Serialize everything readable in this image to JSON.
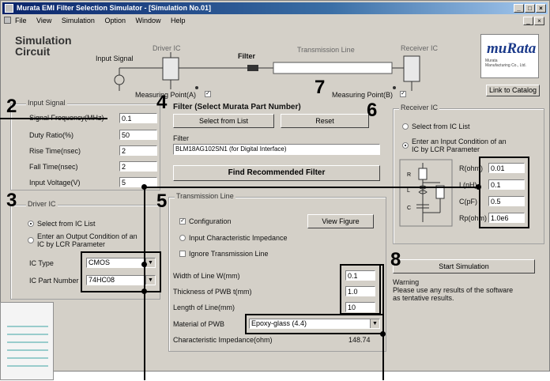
{
  "window": {
    "title": "Murata EMI Filter Selection Simulator - [Simulation No.01]",
    "min_label": "_",
    "max_label": "□",
    "close_label": "×"
  },
  "menu": [
    "File",
    "View",
    "Simulation",
    "Option",
    "Window",
    "Help"
  ],
  "circuit": {
    "heading_line1": "Simulation",
    "heading_line2": "Circuit",
    "input_signal": "Input Signal",
    "driver_ic": "Driver IC",
    "filter": "Filter",
    "transmission_line": "Transmission Line",
    "receiver_ic": "Receiver IC",
    "measuring_point_a": "Measuring Point(A)",
    "measuring_point_b": "Measuring Point(B)"
  },
  "logo": {
    "word": "muRata",
    "sub_line1": "Murata",
    "sub_line2": "Manufacturing Co., Ltd."
  },
  "link_catalog": "Link to Catalog",
  "input_signal": {
    "title": "Input Signal",
    "fields": [
      {
        "label": "Signal Frequency(MHz)",
        "value": "0.1"
      },
      {
        "label": "Duty Ratio(%)",
        "value": "50"
      },
      {
        "label": "Rise Time(nsec)",
        "value": "2"
      },
      {
        "label": "Fall Time(nsec)",
        "value": "2"
      },
      {
        "label": "Input Voltage(V)",
        "value": "5"
      }
    ]
  },
  "driver_ic": {
    "title": "Driver IC",
    "opt_select": "Select from IC List",
    "opt_enter_line1": "Enter an Output Condition of an",
    "opt_enter_line2": "IC by LCR Parameter",
    "ic_type_label": "IC Type",
    "ic_type_value": "CMOS",
    "ic_part_label": "IC Part Number",
    "ic_part_value": "74HC08"
  },
  "filter": {
    "title": "Filter (Select Murata Part Number)",
    "select_button": "Select from List",
    "reset_button": "Reset",
    "filter_label": "Filter",
    "filter_value": "BLM18AG102SN1 (for Digital Interface)",
    "find_button": "Find Recommended Filter"
  },
  "transmission": {
    "title": "Transmission Line",
    "opt_config": "Configuration",
    "opt_impedance": "Input Characteristic Impedance",
    "opt_ignore": "Ignore Transmission Line",
    "view_button": "View Figure",
    "width_label": "Width of Line W(mm)",
    "width_value": "0.1",
    "thickness_label": "Thickness of PWB t(mm)",
    "thickness_value": "1.0",
    "length_label": "Length of Line(mm)",
    "length_value": "10",
    "material_label": "Material of PWB",
    "material_value": "Epoxy-glass (4.4)",
    "impedance_label": "Characteristic Impedance(ohm)",
    "impedance_value": "148.74"
  },
  "receiver": {
    "title": "Receiver IC",
    "opt_select": "Select from IC List",
    "opt_enter_line1": "Enter an Input Condition of an",
    "opt_enter_line2": "IC by LCR Parameter",
    "r_label": "R(ohm)",
    "r_value": "0.01",
    "l_label": "L(nH)",
    "l_value": "0.1",
    "c_label": "C(pF)",
    "c_value": "0.5",
    "rp_label": "Rp(ohm)",
    "rp_value": "1.0e6"
  },
  "start_button": "Start Simulation",
  "warning": {
    "title": "Warning",
    "line1": "Please use any results of the software",
    "line2": "as tentative results."
  },
  "callouts": {
    "n2": "2",
    "n3": "3",
    "n4": "4",
    "n5": "5",
    "n6": "6",
    "n7": "7",
    "n8": "8"
  }
}
